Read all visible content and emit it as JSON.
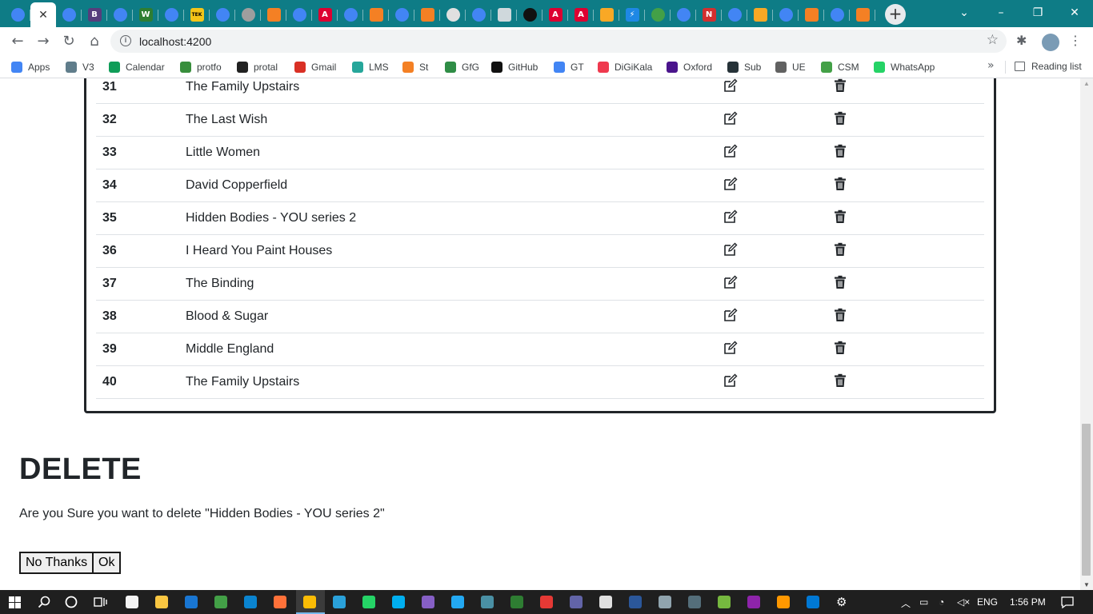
{
  "browser": {
    "url": "localhost:4200",
    "window_controls": [
      "minimize",
      "restore",
      "close"
    ]
  },
  "tabs": [
    {
      "icon": "google-icon",
      "color": "#4285f4",
      "round": true
    },
    {
      "icon": "close-tab-icon",
      "active": true
    },
    {
      "icon": "google-icon",
      "color": "#4285f4",
      "round": true
    },
    {
      "icon": "bootstrap-icon",
      "color": "#563d7c",
      "glyph": "B"
    },
    {
      "icon": "google-icon",
      "color": "#4285f4",
      "round": true
    },
    {
      "icon": "w-icon",
      "color": "#2e7d32",
      "glyph": "W"
    },
    {
      "icon": "google-icon",
      "color": "#4285f4",
      "round": true
    },
    {
      "icon": "tek-icon",
      "color": "#f5c518",
      "glyph": "TEK"
    },
    {
      "icon": "google-icon",
      "color": "#4285f4",
      "round": true
    },
    {
      "icon": "grey-circle-icon",
      "color": "#9e9e9e",
      "round": true
    },
    {
      "icon": "stackoverflow-icon",
      "color": "#f48024"
    },
    {
      "icon": "google-icon",
      "color": "#4285f4",
      "round": true
    },
    {
      "icon": "angular-icon",
      "color": "#dd0031",
      "glyph": "A"
    },
    {
      "icon": "google-icon",
      "color": "#4285f4",
      "round": true
    },
    {
      "icon": "stackoverflow-icon",
      "color": "#f48024"
    },
    {
      "icon": "google-icon",
      "color": "#4285f4",
      "round": true
    },
    {
      "icon": "stackoverflow-icon",
      "color": "#f48024"
    },
    {
      "icon": "baseball-icon",
      "color": "#e0e0e0",
      "round": true
    },
    {
      "icon": "google-icon",
      "color": "#4285f4",
      "round": true
    },
    {
      "icon": "sketch-icon",
      "color": "#cfd8dc"
    },
    {
      "icon": "github-icon",
      "color": "#111111",
      "round": true
    },
    {
      "icon": "angular-icon",
      "color": "#dd0031",
      "glyph": "A"
    },
    {
      "icon": "angular-icon",
      "color": "#dd0031",
      "glyph": "A"
    },
    {
      "icon": "shield-icon",
      "color": "#f9a825"
    },
    {
      "icon": "bolt-icon",
      "color": "#1e88e5",
      "glyph": "⚡"
    },
    {
      "icon": "chrome-icon",
      "color": "#43a047",
      "round": true
    },
    {
      "icon": "google-icon",
      "color": "#4285f4",
      "round": true
    },
    {
      "icon": "n-icon",
      "color": "#d32f2f",
      "glyph": "N"
    },
    {
      "icon": "google-icon",
      "color": "#4285f4",
      "round": true
    },
    {
      "icon": "shield-icon",
      "color": "#f9a825"
    },
    {
      "icon": "google-icon",
      "color": "#4285f4",
      "round": true
    },
    {
      "icon": "stackoverflow-icon",
      "color": "#f48024"
    },
    {
      "icon": "google-icon",
      "color": "#4285f4",
      "round": true
    },
    {
      "icon": "stackoverflow-icon",
      "color": "#f48024"
    }
  ],
  "bookmarks": [
    {
      "label": "Apps",
      "icon": "apps-grid-icon",
      "color": "#4285f4"
    },
    {
      "label": "V3",
      "icon": "v3-icon",
      "color": "#607d8b"
    },
    {
      "label": "Calendar",
      "icon": "calendar-icon",
      "color": "#0f9d58"
    },
    {
      "label": "protfo",
      "icon": "protfo-icon",
      "color": "#388e3c"
    },
    {
      "label": "protal",
      "icon": "protal-icon",
      "color": "#212121"
    },
    {
      "label": "Gmail",
      "icon": "gmail-icon",
      "color": "#d93025"
    },
    {
      "label": "LMS",
      "icon": "lms-icon",
      "color": "#26a69a"
    },
    {
      "label": "St",
      "icon": "stackoverflow-icon",
      "color": "#f48024"
    },
    {
      "label": "GfG",
      "icon": "gfg-icon",
      "color": "#2f8d46"
    },
    {
      "label": "GitHub",
      "icon": "github-icon",
      "color": "#111111"
    },
    {
      "label": "GT",
      "icon": "google-translate-icon",
      "color": "#4285f4"
    },
    {
      "label": "DiGiKala",
      "icon": "digikala-icon",
      "color": "#ef394e"
    },
    {
      "label": "Oxford",
      "icon": "oxford-icon",
      "color": "#4a148c"
    },
    {
      "label": "Sub",
      "icon": "sub-icon",
      "color": "#263238"
    },
    {
      "label": "UE",
      "icon": "ue-icon",
      "color": "#616161"
    },
    {
      "label": "CSM",
      "icon": "csm-icon",
      "color": "#43a047"
    },
    {
      "label": "WhatsApp",
      "icon": "whatsapp-icon",
      "color": "#25d366"
    }
  ],
  "reading_list": "Reading list",
  "books": [
    {
      "id": "31",
      "title": "The Family Upstairs"
    },
    {
      "id": "32",
      "title": "The Last Wish"
    },
    {
      "id": "33",
      "title": "Little Women"
    },
    {
      "id": "34",
      "title": "David Copperfield"
    },
    {
      "id": "35",
      "title": "Hidden Bodies - YOU series 2"
    },
    {
      "id": "36",
      "title": "I Heard You Paint Houses"
    },
    {
      "id": "37",
      "title": "The Binding"
    },
    {
      "id": "38",
      "title": "Blood & Sugar"
    },
    {
      "id": "39",
      "title": "Middle England"
    },
    {
      "id": "40",
      "title": "The Family Upstairs"
    }
  ],
  "delete_section": {
    "heading": "DELETE",
    "message": "Are you Sure you want to delete \"Hidden Bodies - YOU series 2\"",
    "no_label": "No Thanks",
    "ok_label": "Ok"
  },
  "taskbar": {
    "apps": [
      {
        "icon": "file-explorer-icon",
        "color": "#f9c642"
      },
      {
        "icon": "mail-icon",
        "color": "#1976d2"
      },
      {
        "icon": "xbox-game-icon",
        "color": "#43a047"
      },
      {
        "icon": "edge-icon",
        "color": "#0a84d0"
      },
      {
        "icon": "firefox-icon",
        "color": "#ff7139"
      },
      {
        "icon": "chrome-icon",
        "color": "#fbbc05"
      },
      {
        "icon": "telegram-icon",
        "color": "#2aa1da"
      },
      {
        "icon": "whatsapp-icon",
        "color": "#25d366"
      },
      {
        "icon": "skype-icon",
        "color": "#00aff0"
      },
      {
        "icon": "visual-studio-icon",
        "color": "#865fc5"
      },
      {
        "icon": "vscode-icon",
        "color": "#23a9f2"
      },
      {
        "icon": "sql-icon",
        "color": "#4a90a4"
      },
      {
        "icon": "excel-like-icon",
        "color": "#2e7d32"
      },
      {
        "icon": "bolt-icon",
        "color": "#e53935"
      },
      {
        "icon": "teams-icon",
        "color": "#6264a7"
      },
      {
        "icon": "paint-icon",
        "color": "#e0e0e0"
      },
      {
        "icon": "word-icon",
        "color": "#2b579a"
      },
      {
        "icon": "calculator-icon",
        "color": "#90a4ae"
      },
      {
        "icon": "camera-icon",
        "color": "#546e7a"
      },
      {
        "icon": "utorrent-icon",
        "color": "#76b83f"
      },
      {
        "icon": "terminal-icon",
        "color": "#8e24aa"
      },
      {
        "icon": "sublime-icon",
        "color": "#ff9800"
      },
      {
        "icon": "remote-desktop-icon",
        "color": "#0078d4"
      },
      {
        "icon": "settings-icon",
        "color": "#ffffff"
      }
    ],
    "tray": {
      "language": "ENG",
      "time": "1:56 PM"
    }
  }
}
